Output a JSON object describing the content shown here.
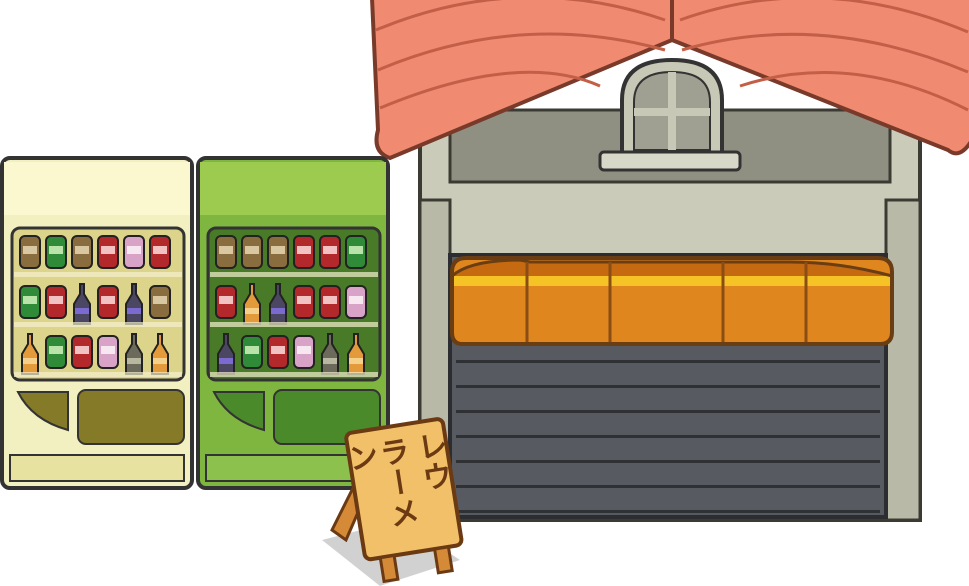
{
  "scene": {
    "vending_machines": [
      {
        "name": "yellow",
        "colors": {
          "body": "#f2efc0",
          "top": "#fbf8d0",
          "inner": "#dcd48a",
          "panel": "#857a28",
          "flap": "#857a28",
          "tray": "#e7e29f"
        },
        "shelves": [
          [
            "can-brown",
            "can-green",
            "can-brown",
            "can-red",
            "can-pink",
            "can-red"
          ],
          [
            "can-green",
            "can-red",
            "bottle-dark",
            "can-red",
            "bottle-dark",
            "can-brown"
          ],
          [
            "bottle-orange",
            "can-green",
            "can-red",
            "can-pink",
            "bottle-grey",
            "bottle-orange"
          ]
        ]
      },
      {
        "name": "green",
        "colors": {
          "body": "#7fb640",
          "top": "#9ccb4f",
          "inner": "#497a27",
          "panel": "#4a8a2a",
          "flap": "#4a8a2a",
          "tray": "#8bc14c"
        },
        "shelves": [
          [
            "can-brown",
            "can-brown",
            "can-brown",
            "can-red",
            "can-red",
            "can-green"
          ],
          [
            "can-red",
            "bottle-orange",
            "bottle-dark",
            "can-red",
            "can-red",
            "can-pink"
          ],
          [
            "bottle-dark",
            "can-green",
            "can-red",
            "can-pink",
            "bottle-grey",
            "bottle-orange"
          ]
        ]
      }
    ],
    "building": {
      "roof_color": "#f08b72",
      "wall_color": "#cbcbb9",
      "awning_color": "#e0861f",
      "shutter_color": "#575a60"
    },
    "sign": {
      "columns": [
        "ラーメン",
        "レウ"
      ],
      "color": "#f3c06a"
    }
  }
}
